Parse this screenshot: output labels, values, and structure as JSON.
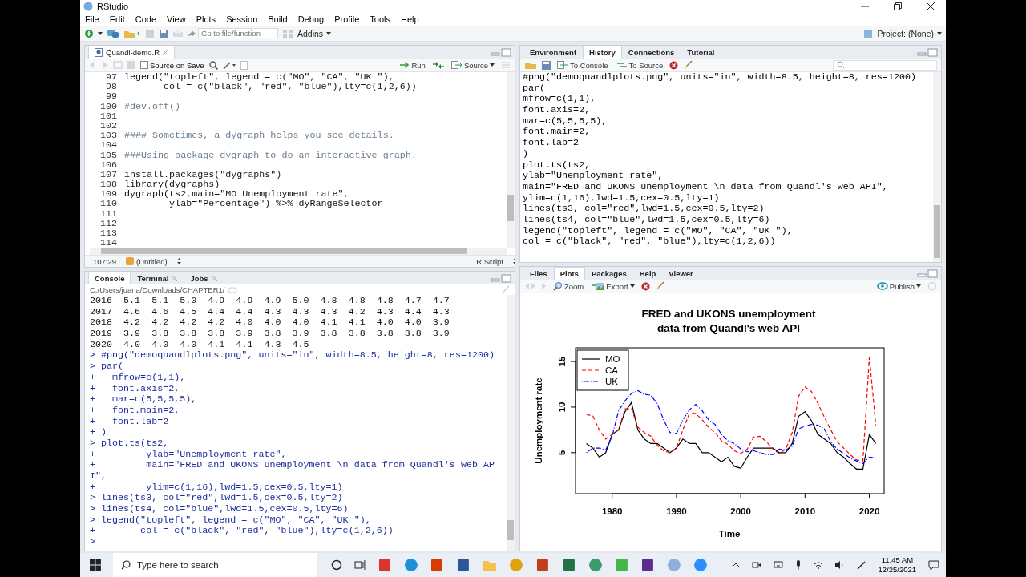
{
  "window": {
    "title": "RStudio"
  },
  "menu": [
    "File",
    "Edit",
    "Code",
    "View",
    "Plots",
    "Session",
    "Build",
    "Debug",
    "Profile",
    "Tools",
    "Help"
  ],
  "toolbar": {
    "goto": {
      "placeholder": "Go to file/function"
    },
    "addins": "Addins",
    "project": "Project: (None)"
  },
  "editor": {
    "tabs": [
      {
        "label": "Quandl-demo.R",
        "selected": true
      }
    ],
    "source_on_save": {
      "label": "Source on Save",
      "checked": false
    },
    "run": "Run",
    "source": "Source",
    "lines": [
      {
        "n": "97",
        "code": "legend(\"topleft\", legend = c(\"MO\", \"CA\", \"UK \"),",
        "kind": "code"
      },
      {
        "n": "98",
        "code": "       col = c(\"black\", \"red\", \"blue\"),lty=c(1,2,6))",
        "kind": "code"
      },
      {
        "n": "99"
      },
      {
        "n": "100",
        "code": "#dev.off()",
        "kind": "comment"
      },
      {
        "n": "101"
      },
      {
        "n": "102"
      },
      {
        "n": "103",
        "code": "#### Sometimes, a dygraph helps you see details.",
        "kind": "comment"
      },
      {
        "n": "104"
      },
      {
        "n": "105",
        "code": "###Using package dygraph to do an interactive graph.",
        "kind": "comment"
      },
      {
        "n": "106"
      },
      {
        "n": "107",
        "code": "install.packages(\"dygraphs\")",
        "kind": "code"
      },
      {
        "n": "108",
        "code": "library(dygraphs)",
        "kind": "code"
      },
      {
        "n": "109",
        "code": "dygraph(ts2,main=\"MO Unemployment rate\",",
        "kind": "code"
      },
      {
        "n": "110",
        "code": "        ylab=\"Percentage\") %>% dyRangeSelector",
        "kind": "code"
      },
      {
        "n": "111"
      },
      {
        "n": "112"
      },
      {
        "n": "113"
      },
      {
        "n": "114"
      }
    ],
    "status": {
      "position": "107:29",
      "scope": "(Untitled)",
      "filetype": "R Script"
    }
  },
  "history_pane": {
    "tabs": [
      {
        "label": "Environment",
        "selected": false
      },
      {
        "label": "History",
        "selected": true
      },
      {
        "label": "Connections",
        "selected": false
      },
      {
        "label": "Tutorial",
        "selected": false
      }
    ],
    "to_console": "To Console",
    "to_source": "To Source",
    "lines": [
      "#png(\"demoquandlplots.png\", units=\"in\", width=8.5, height=8, res=1200)",
      "par(",
      "mfrow=c(1,1),",
      "font.axis=2,",
      "mar=c(5,5,5,5),",
      "font.main=2,",
      "font.lab=2",
      ")",
      "plot.ts(ts2,",
      "ylab=\"Unemployment rate\",",
      "main=\"FRED and UKONS unemployment \\n data from Quandl's web API\",",
      "ylim=c(1,16),lwd=1.5,cex=0.5,lty=1)",
      "lines(ts3, col=\"red\",lwd=1.5,cex=0.5,lty=2)",
      "lines(ts4, col=\"blue\",lwd=1.5,cex=0.5,lty=6)",
      "legend(\"topleft\", legend = c(\"MO\", \"CA\", \"UK \"),",
      "col = c(\"black\", \"red\", \"blue\"),lty=c(1,2,6))"
    ]
  },
  "console_pane": {
    "tabs": [
      {
        "label": "Console",
        "selected": true,
        "closable": false
      },
      {
        "label": "Terminal",
        "selected": false,
        "closable": true
      },
      {
        "label": "Jobs",
        "selected": false,
        "closable": true
      }
    ],
    "path": "C:/Users/juana/Downloads/CHAPTER1/",
    "lines": [
      {
        "text": "2016  5.1  5.1  5.0  4.9  4.9  4.9  5.0  4.8  4.8  4.8  4.7  4.7",
        "kind": "output"
      },
      {
        "text": "2017  4.6  4.6  4.5  4.4  4.4  4.3  4.3  4.3  4.2  4.3  4.4  4.3",
        "kind": "output"
      },
      {
        "text": "2018  4.2  4.2  4.2  4.2  4.0  4.0  4.0  4.1  4.1  4.0  4.0  3.9",
        "kind": "output"
      },
      {
        "text": "2019  3.9  3.8  3.8  3.8  3.9  3.8  3.9  3.8  3.8  3.8  3.8  3.9",
        "kind": "output"
      },
      {
        "text": "2020  4.0  4.0  4.0  4.1  4.1  4.3  4.5",
        "kind": "output"
      },
      {
        "text": "> #png(\"demoquandlplots.png\", units=\"in\", width=8.5, height=8, res=1200)",
        "kind": "input"
      },
      {
        "text": "> par(",
        "kind": "input"
      },
      {
        "text": "+   mfrow=c(1,1),",
        "kind": "input"
      },
      {
        "text": "+   font.axis=2,",
        "kind": "input"
      },
      {
        "text": "+   mar=c(5,5,5,5),",
        "kind": "input"
      },
      {
        "text": "+   font.main=2,",
        "kind": "input"
      },
      {
        "text": "+   font.lab=2",
        "kind": "input"
      },
      {
        "text": "+ )",
        "kind": "input"
      },
      {
        "text": "> plot.ts(ts2,",
        "kind": "input"
      },
      {
        "text": "+         ylab=\"Unemployment rate\",",
        "kind": "input"
      },
      {
        "text": "+         main=\"FRED and UKONS unemployment \\n data from Quandl's web AP",
        "kind": "input"
      },
      {
        "text": "I\",",
        "kind": "input"
      },
      {
        "text": "+         ylim=c(1,16),lwd=1.5,cex=0.5,lty=1)",
        "kind": "input"
      },
      {
        "text": "> lines(ts3, col=\"red\",lwd=1.5,cex=0.5,lty=2)",
        "kind": "input"
      },
      {
        "text": "> lines(ts4, col=\"blue\",lwd=1.5,cex=0.5,lty=6)",
        "kind": "input"
      },
      {
        "text": "> legend(\"topleft\", legend = c(\"MO\", \"CA\", \"UK \"),",
        "kind": "input"
      },
      {
        "text": "+        col = c(\"black\", \"red\", \"blue\"),lty=c(1,2,6))",
        "kind": "input"
      },
      {
        "text": ">",
        "kind": "input"
      }
    ]
  },
  "plots_pane": {
    "tabs": [
      {
        "label": "Files",
        "selected": false
      },
      {
        "label": "Plots",
        "selected": true
      },
      {
        "label": "Packages",
        "selected": false
      },
      {
        "label": "Help",
        "selected": false
      },
      {
        "label": "Viewer",
        "selected": false
      }
    ],
    "zoom": "Zoom",
    "export": "Export",
    "publish": "Publish",
    "chart_data": {
      "type": "line",
      "title": "FRED and UKONS unemployment\ndata from Quandl's web API",
      "xlabel": "Time",
      "ylabel": "Unemployment rate",
      "x": [
        1976,
        1977,
        1978,
        1979,
        1980,
        1981,
        1982,
        1983,
        1984,
        1985,
        1986,
        1987,
        1988,
        1989,
        1990,
        1991,
        1992,
        1993,
        1994,
        1995,
        1996,
        1997,
        1998,
        1999,
        2000,
        2001,
        2002,
        2003,
        2004,
        2005,
        2006,
        2007,
        2008,
        2009,
        2010,
        2011,
        2012,
        2013,
        2014,
        2015,
        2016,
        2017,
        2018,
        2019,
        2020,
        2021
      ],
      "series": [
        {
          "name": "MO",
          "color": "#000000",
          "line_style": "solid",
          "values": [
            6,
            5.5,
            4.5,
            5,
            7,
            7.5,
            9.5,
            10.5,
            7.5,
            6.5,
            6,
            6,
            5.5,
            5,
            5.5,
            6.5,
            6,
            6,
            5,
            5,
            4.5,
            4,
            4.5,
            3.5,
            3.3,
            4.5,
            5.5,
            5.5,
            5.5,
            5.5,
            5,
            5,
            6,
            9,
            9.5,
            8.5,
            7,
            6.5,
            6,
            5,
            4.5,
            3.8,
            3.2,
            3.2,
            7,
            6
          ]
        },
        {
          "name": "CA",
          "color": "#ff0000",
          "line_style": "dashed",
          "values": [
            9.2,
            9,
            7.5,
            6.5,
            7,
            7.5,
            9.8,
            9.8,
            7.8,
            7.2,
            6.8,
            5.8,
            5.2,
            5,
            5.5,
            7.5,
            9.3,
            9.3,
            8.6,
            7.8,
            7.2,
            6.3,
            5.9,
            5.2,
            4.9,
            5.4,
            6.7,
            6.8,
            6.2,
            5.4,
            4.9,
            5.4,
            7.2,
            11.2,
            12.2,
            11.7,
            10.4,
            8.9,
            7.5,
            6.2,
            5.5,
            4.8,
            4.2,
            4.1,
            15.5,
            8
          ]
        },
        {
          "name": "UK",
          "color": "#0000ff",
          "line_style": "dotdash",
          "values": [
            5,
            5.5,
            5.5,
            5.3,
            6.8,
            9.6,
            10.7,
            11.5,
            11.8,
            11.4,
            11.3,
            10.4,
            8.6,
            7.2,
            7.1,
            8.6,
            9.7,
            10.3,
            9.6,
            8.6,
            8.1,
            7,
            6.3,
            6,
            5.4,
            5.1,
            5.2,
            5,
            4.8,
            4.8,
            5.4,
            5.3,
            5.7,
            7.6,
            7.9,
            8.1,
            8,
            7.6,
            6.2,
            5.4,
            4.9,
            4.4,
            4.1,
            3.8,
            4.5,
            4.5
          ]
        }
      ],
      "legend": true,
      "xlim": [
        1974.3,
        2022.3
      ],
      "ylim": [
        0.5,
        16.5
      ],
      "xticks": [
        1980,
        1990,
        2000,
        2010,
        2020
      ],
      "yticks": [
        5,
        10,
        15
      ]
    }
  },
  "taskbar": {
    "search": {
      "placeholder": "Type here to search"
    },
    "time": "11:45 AM",
    "date": "12/25/2021"
  }
}
